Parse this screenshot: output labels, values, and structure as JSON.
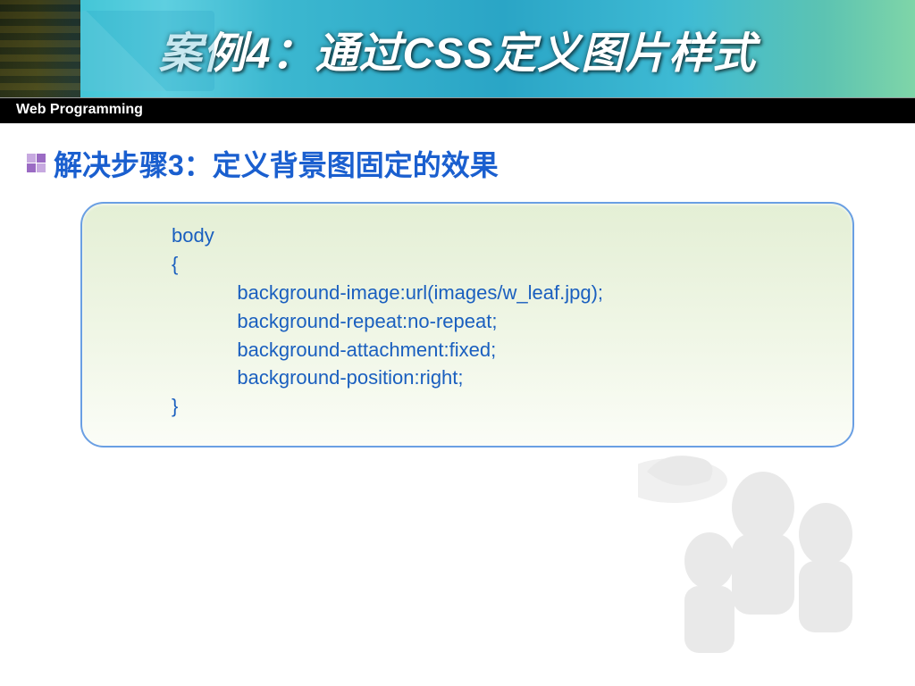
{
  "banner": {
    "title": "案例4：通过CSS定义图片样式"
  },
  "subbar": {
    "label": "Web Programming"
  },
  "heading": {
    "text": "解决步骤3：定义背景图固定的效果"
  },
  "code": {
    "selector": "body",
    "open": "{",
    "line1": "background-image:url(images/w_leaf.jpg);",
    "line2": "background-repeat:no-repeat;",
    "line3": "background-attachment:fixed;",
    "line4": "background-position:right;",
    "close": "}"
  }
}
